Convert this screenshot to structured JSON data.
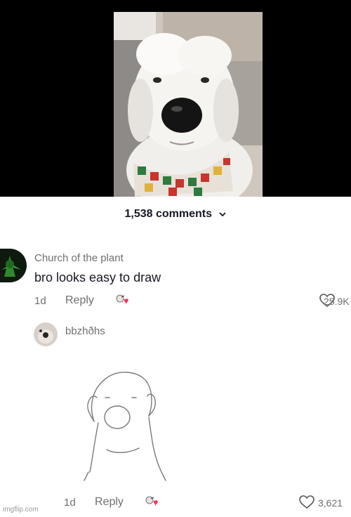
{
  "header": {
    "comments_count": "1,538 comments"
  },
  "comments": [
    {
      "username": "Church of the plant",
      "text": "bro looks easy to draw",
      "time": "1d",
      "reply_label": "Reply",
      "likes": "25.9K"
    },
    {
      "username": "bbzhðhs",
      "time": "1d",
      "reply_label": "Reply",
      "likes": "3,621"
    }
  ],
  "watermark": "imgflip.com",
  "icons": {
    "chevron": "chevron-down-icon",
    "heart": "heart-outline-icon",
    "creator_like": "creator-liked-icon"
  },
  "colors": {
    "video_bg": "#000000",
    "text_primary": "#161823",
    "text_secondary": "#6f6f6f",
    "creator_heart": "#fe2c55"
  }
}
